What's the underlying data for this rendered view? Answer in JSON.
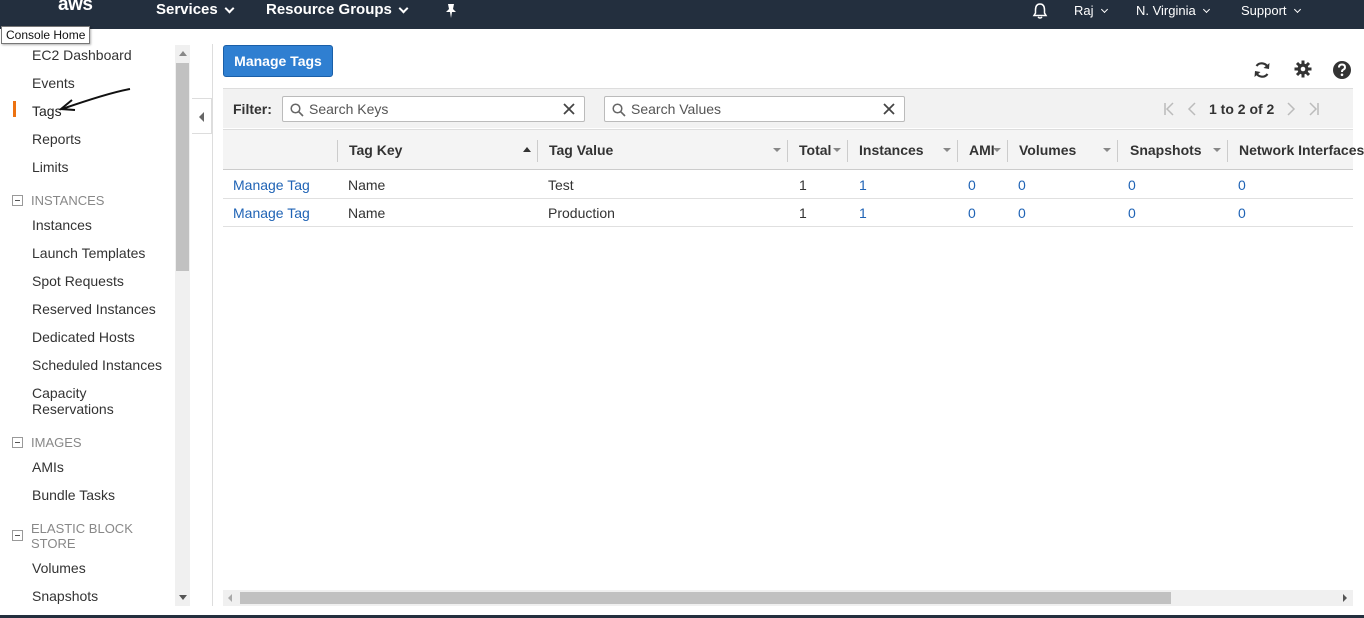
{
  "topnav": {
    "logo": "aws",
    "services": "Services",
    "resource_groups": "Resource Groups",
    "user": "Raj",
    "region": "N. Virginia",
    "support": "Support",
    "tooltip": "Console Home"
  },
  "sidebar": {
    "items": [
      "EC2 Dashboard",
      "Events",
      "Tags",
      "Reports",
      "Limits"
    ],
    "sections": [
      {
        "title": "INSTANCES",
        "items": [
          "Instances",
          "Launch Templates",
          "Spot Requests",
          "Reserved Instances",
          "Dedicated Hosts",
          "Scheduled Instances",
          "Capacity Reservations"
        ]
      },
      {
        "title": "IMAGES",
        "items": [
          "AMIs",
          "Bundle Tasks"
        ]
      },
      {
        "title": "ELASTIC BLOCK STORE",
        "items": [
          "Volumes",
          "Snapshots"
        ]
      }
    ],
    "active_item": "Tags"
  },
  "main": {
    "manage_tags_button": "Manage Tags",
    "filter_label": "Filter:",
    "search_keys_placeholder": "Search Keys",
    "search_values_placeholder": "Search Values",
    "pager_text": "1 to 2 of 2",
    "columns": [
      "Tag Key",
      "Tag Value",
      "Total",
      "Instances",
      "AMI",
      "Volumes",
      "Snapshots",
      "Network Interfaces"
    ],
    "rows": [
      {
        "action": "Manage Tag",
        "key": "Name",
        "value": "Test",
        "total": "1",
        "instances": "1",
        "ami": "0",
        "volumes": "0",
        "snapshots": "0",
        "network_interfaces": "0"
      },
      {
        "action": "Manage Tag",
        "key": "Name",
        "value": "Production",
        "total": "1",
        "instances": "1",
        "ami": "0",
        "volumes": "0",
        "snapshots": "0",
        "network_interfaces": "0"
      }
    ]
  },
  "colors": {
    "nav_bg": "#232f3e",
    "primary_button": "#2f7fd1",
    "link": "#1f63b5",
    "active_indicator": "#ec7211"
  }
}
